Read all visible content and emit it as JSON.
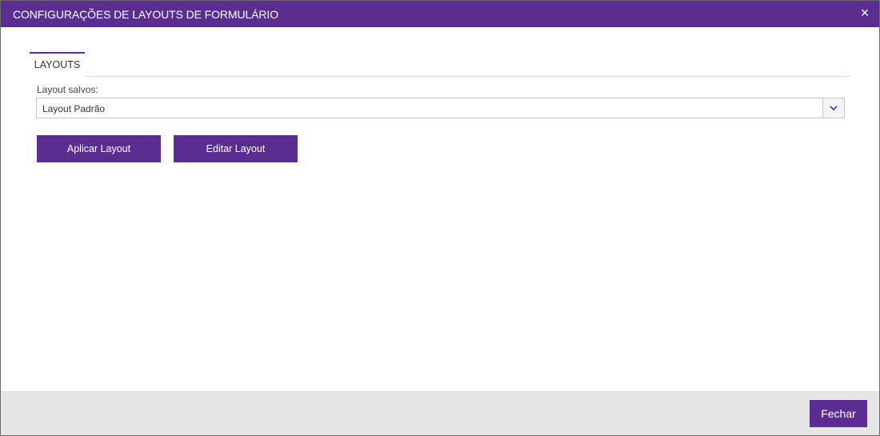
{
  "dialog": {
    "title": "CONFIGURAÇÕES DE LAYOUTS DE FORMULÁRIO",
    "close_icon": "×"
  },
  "tabs": [
    {
      "label": "LAYOUTS",
      "active": true
    }
  ],
  "layout_select": {
    "label": "Layout salvos:",
    "value": "Layout Padrão"
  },
  "buttons": {
    "apply_label": "Aplicar Layout",
    "edit_label": "Editar Layout"
  },
  "footer": {
    "close_label": "Fechar"
  },
  "icons": {
    "close": "close-icon",
    "dropdown": "chevron-down-icon"
  },
  "colors": {
    "accent": "#5c2d91",
    "footer_bg": "#e6e6e6",
    "border": "#c8c8c8"
  }
}
